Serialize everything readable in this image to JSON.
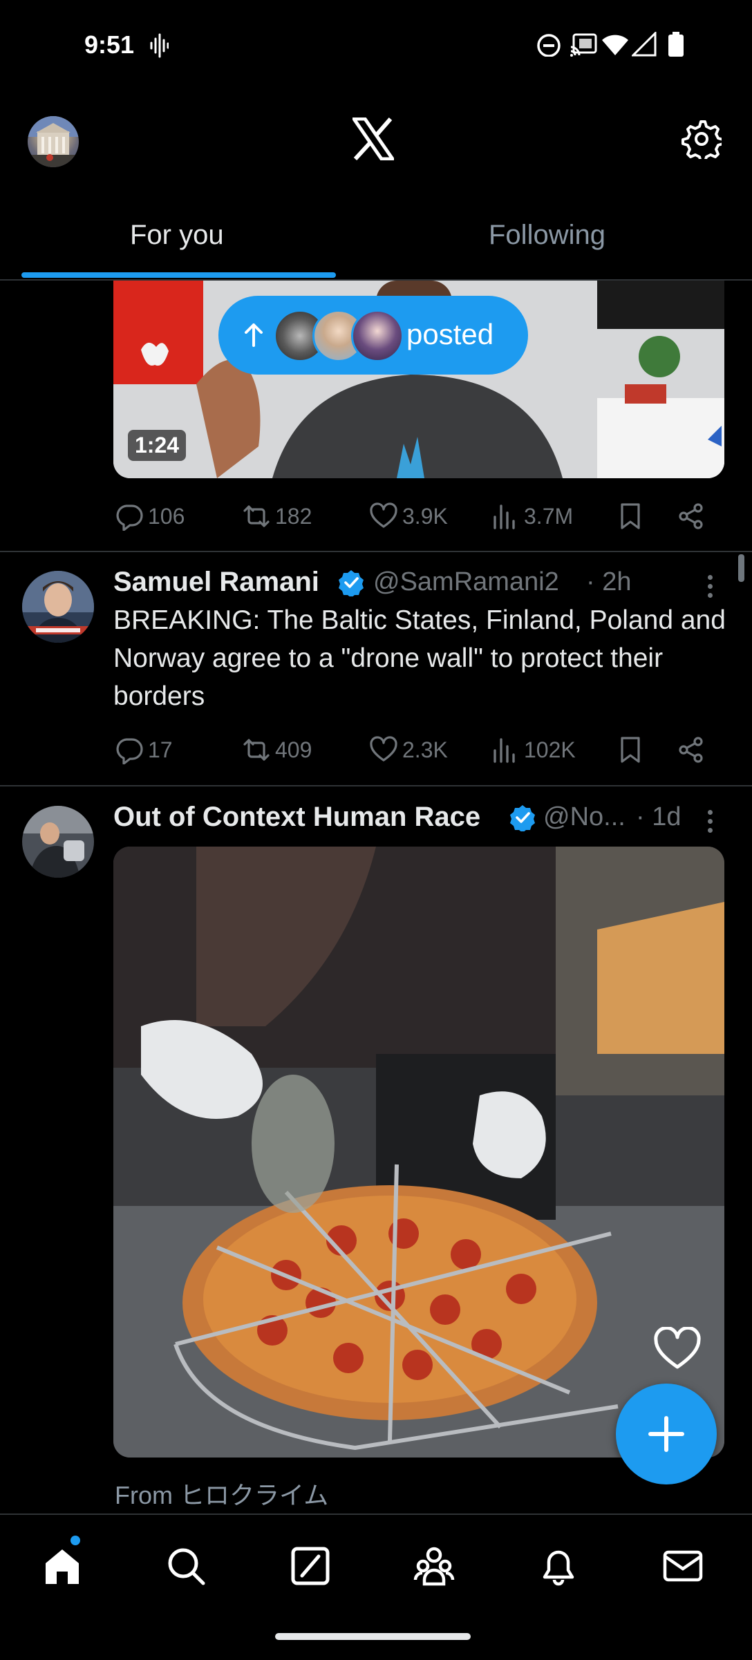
{
  "status_bar": {
    "time": "9:51"
  },
  "header": {
    "tabs": [
      {
        "label": "For you",
        "selected": true
      },
      {
        "label": "Following",
        "selected": false
      }
    ]
  },
  "new_posts_pill": {
    "label": "posted"
  },
  "post_1": {
    "video_duration": "1:24",
    "actions": {
      "replies": "106",
      "reposts": "182",
      "likes": "3.9K",
      "views": "3.7M"
    }
  },
  "post_2": {
    "name": "Samuel Ramani",
    "handle": "@SamRamani2",
    "time": "· 2h",
    "text": "BREAKING: The Baltic States, Finland, Poland and Norway agree to a \"drone wall\" to protect their borders",
    "actions": {
      "replies": "17",
      "reposts": "409",
      "likes": "2.3K",
      "views": "102K"
    }
  },
  "post_3": {
    "name": "Out of Context Human Race",
    "handle": "@No...",
    "time": "· 1d",
    "from_label": "From ヒロクライム"
  },
  "colors": {
    "accent": "#1d9bf0",
    "background": "#000000",
    "muted": "#71767b"
  }
}
